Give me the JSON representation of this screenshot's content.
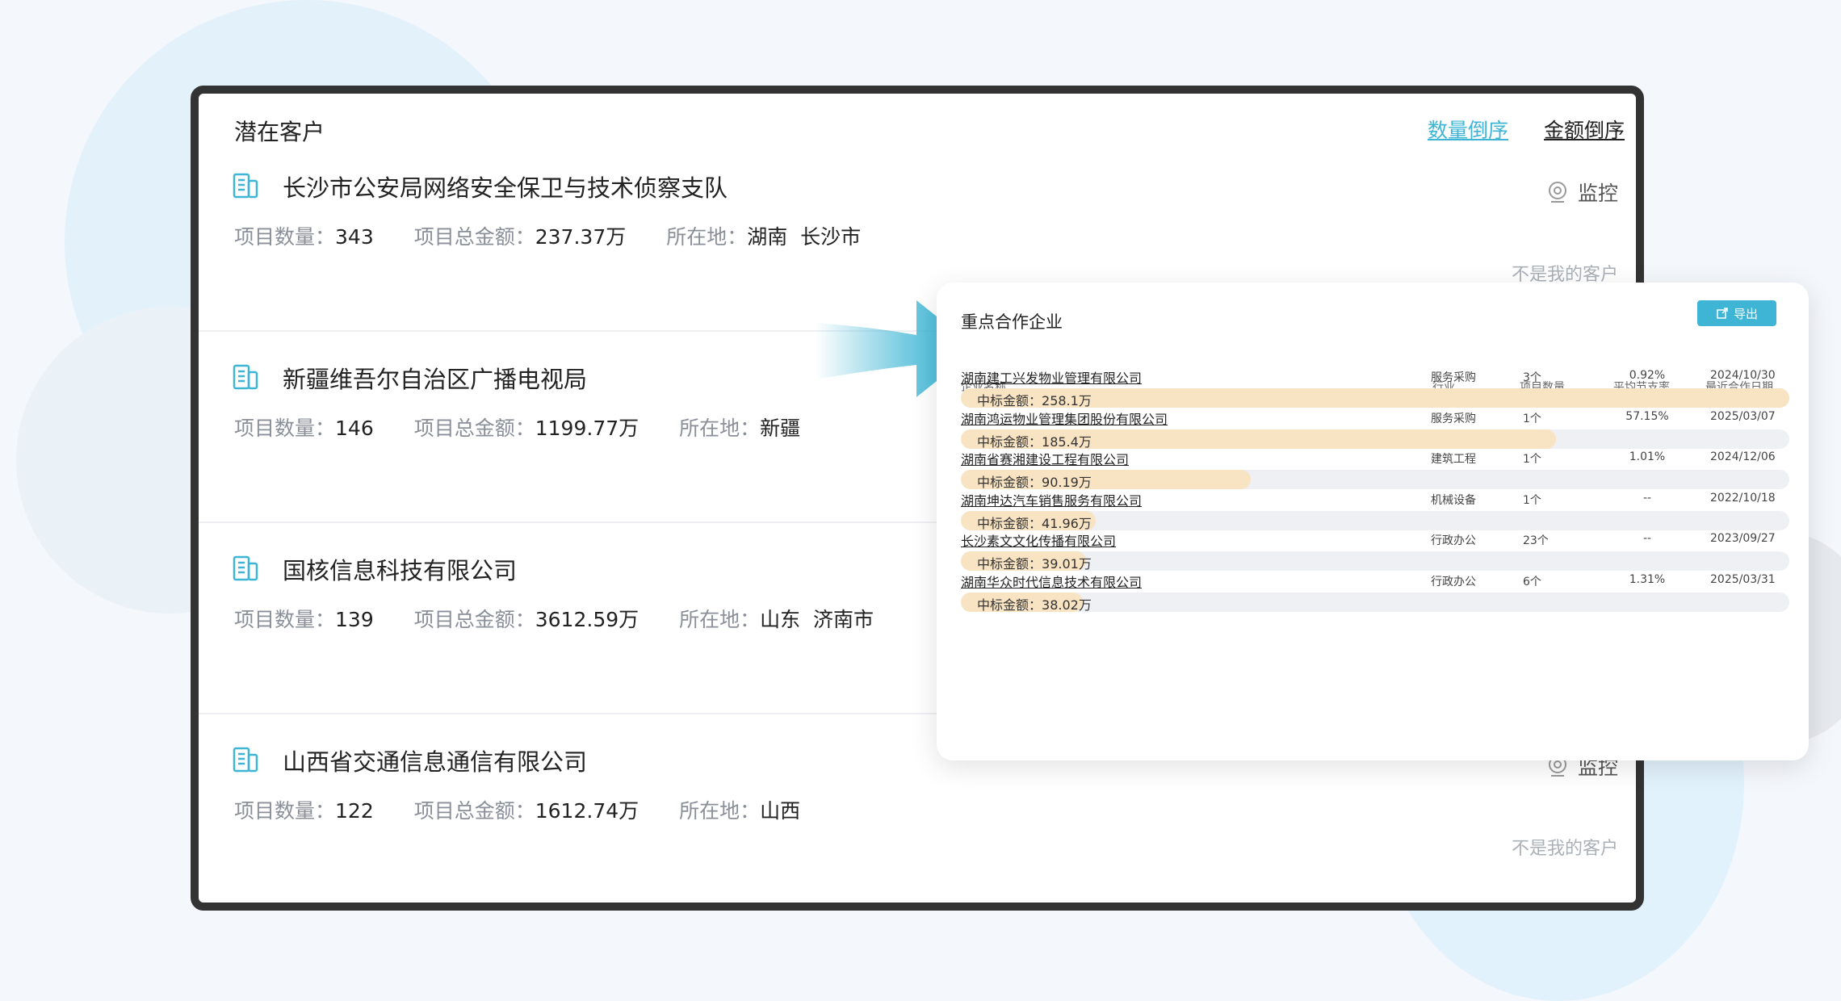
{
  "panel": {
    "title": "潜在客户",
    "sort_count": "数量倒序",
    "sort_amount": "金额倒序"
  },
  "labels": {
    "project_count": "项目数量：",
    "total_amount": "项目总金额：",
    "location": "所在地：",
    "monitor": "监控",
    "not_mine": "不是我的客户"
  },
  "clients": [
    {
      "name": "长沙市公安局网络安全保卫与技术侦察支队",
      "count": "343",
      "amount": "237.37万",
      "location": "湖南  长沙市"
    },
    {
      "name": "新疆维吾尔自治区广播电视局",
      "count": "146",
      "amount": "1199.77万",
      "location": "新疆"
    },
    {
      "name": "国核信息科技有限公司",
      "count": "139",
      "amount": "3612.59万",
      "location": "山东  济南市"
    },
    {
      "name": "山西省交通信息通信有限公司",
      "count": "122",
      "amount": "1612.74万",
      "location": "山西"
    }
  ],
  "popup": {
    "title": "重点合作企业",
    "export_label": "导出",
    "headers": {
      "name": "企业名称",
      "industry": "行业",
      "count": "项目数量",
      "ratio": "平均节支率",
      "date": "最近合作日期"
    },
    "bid_label": "中标金额：",
    "rows": [
      {
        "name": "湖南建工兴发物业管理有限公司",
        "industry": "服务采购",
        "count": "3个",
        "ratio": "0.92%",
        "date": "2024/10/30",
        "amount": "258.1万",
        "amount_value": 258.1
      },
      {
        "name": "湖南鸿运物业管理集团股份有限公司",
        "industry": "服务采购",
        "count": "1个",
        "ratio": "57.15%",
        "date": "2025/03/07",
        "amount": "185.4万",
        "amount_value": 185.4
      },
      {
        "name": "湖南省赛湘建设工程有限公司",
        "industry": "建筑工程",
        "count": "1个",
        "ratio": "1.01%",
        "date": "2024/12/06",
        "amount": "90.19万",
        "amount_value": 90.19
      },
      {
        "name": "湖南坤达汽车销售服务有限公司",
        "industry": "机械设备",
        "count": "1个",
        "ratio": "--",
        "date": "2022/10/18",
        "amount": "41.96万",
        "amount_value": 41.96
      },
      {
        "name": "长沙素文文化传播有限公司",
        "industry": "行政办公",
        "count": "23个",
        "ratio": "--",
        "date": "2023/09/27",
        "amount": "39.01万",
        "amount_value": 39.01
      },
      {
        "name": "湖南华众时代信息技术有限公司",
        "industry": "行政办公",
        "count": "6个",
        "ratio": "1.31%",
        "date": "2025/03/31",
        "amount": "38.02万",
        "amount_value": 38.02
      }
    ]
  },
  "colors": {
    "accent": "#3eb5d5",
    "bar_fill": "#f8e3c2",
    "bar_track": "#eef0f3"
  }
}
